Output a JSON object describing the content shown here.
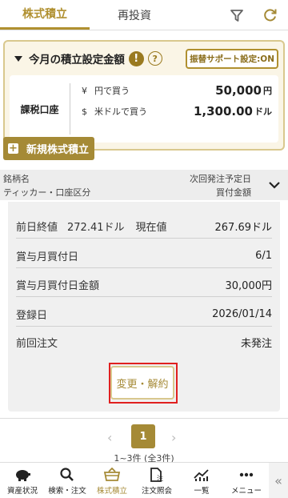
{
  "tabs": [
    {
      "label": "株式積立"
    },
    {
      "label": "再投資"
    }
  ],
  "monthly": {
    "title": "今月の積立設定金額",
    "warn_glyph": "!",
    "help_glyph": "?",
    "support_label": "振替サポート設定:ON",
    "account": "課税口座",
    "rows": [
      {
        "currency": "¥",
        "label": "円で買う",
        "amount": "50,000",
        "unit": "円"
      },
      {
        "currency": "$",
        "label": "米ドルで買う",
        "amount": "1,300.00",
        "unit": "ドル"
      }
    ]
  },
  "new_button": {
    "icon": "+",
    "label": "新規株式積立"
  },
  "header": {
    "left1": "銘柄名",
    "left2": "ティッカー・口座区分",
    "right1": "次回発注予定日",
    "right2": "買付金額"
  },
  "detail": {
    "prev_close_label": "前日終値",
    "prev_close_value": "272.41ドル",
    "current_label": "現在値",
    "current_value": "267.69ドル",
    "lines": [
      {
        "label": "賞与月買付日",
        "value": "6/1"
      },
      {
        "label": "賞与月買付日金額",
        "value": "30,000円"
      },
      {
        "label": "登録日",
        "value": "2026/01/14"
      },
      {
        "label": "前回注文",
        "value": "未発注"
      }
    ],
    "change_button": "変更・解約"
  },
  "pager": {
    "prev": "‹",
    "next": "›",
    "current": "1",
    "count": "1~3件 (全3件)"
  },
  "nav": [
    {
      "label": "資産状況",
      "icon": "piggy-bank-icon"
    },
    {
      "label": "検索・注文",
      "icon": "search-icon"
    },
    {
      "label": "株式積立",
      "icon": "basket-icon"
    },
    {
      "label": "注文照会",
      "icon": "order-document-icon"
    },
    {
      "label": "一覧",
      "icon": "chart-icon"
    },
    {
      "label": "メニュー",
      "icon": "menu-dots-icon"
    }
  ],
  "collapse_glyph": "«",
  "doc_glyph": "注",
  "colors": {
    "accent": "#a58a36",
    "highlight": "#e0201f"
  }
}
